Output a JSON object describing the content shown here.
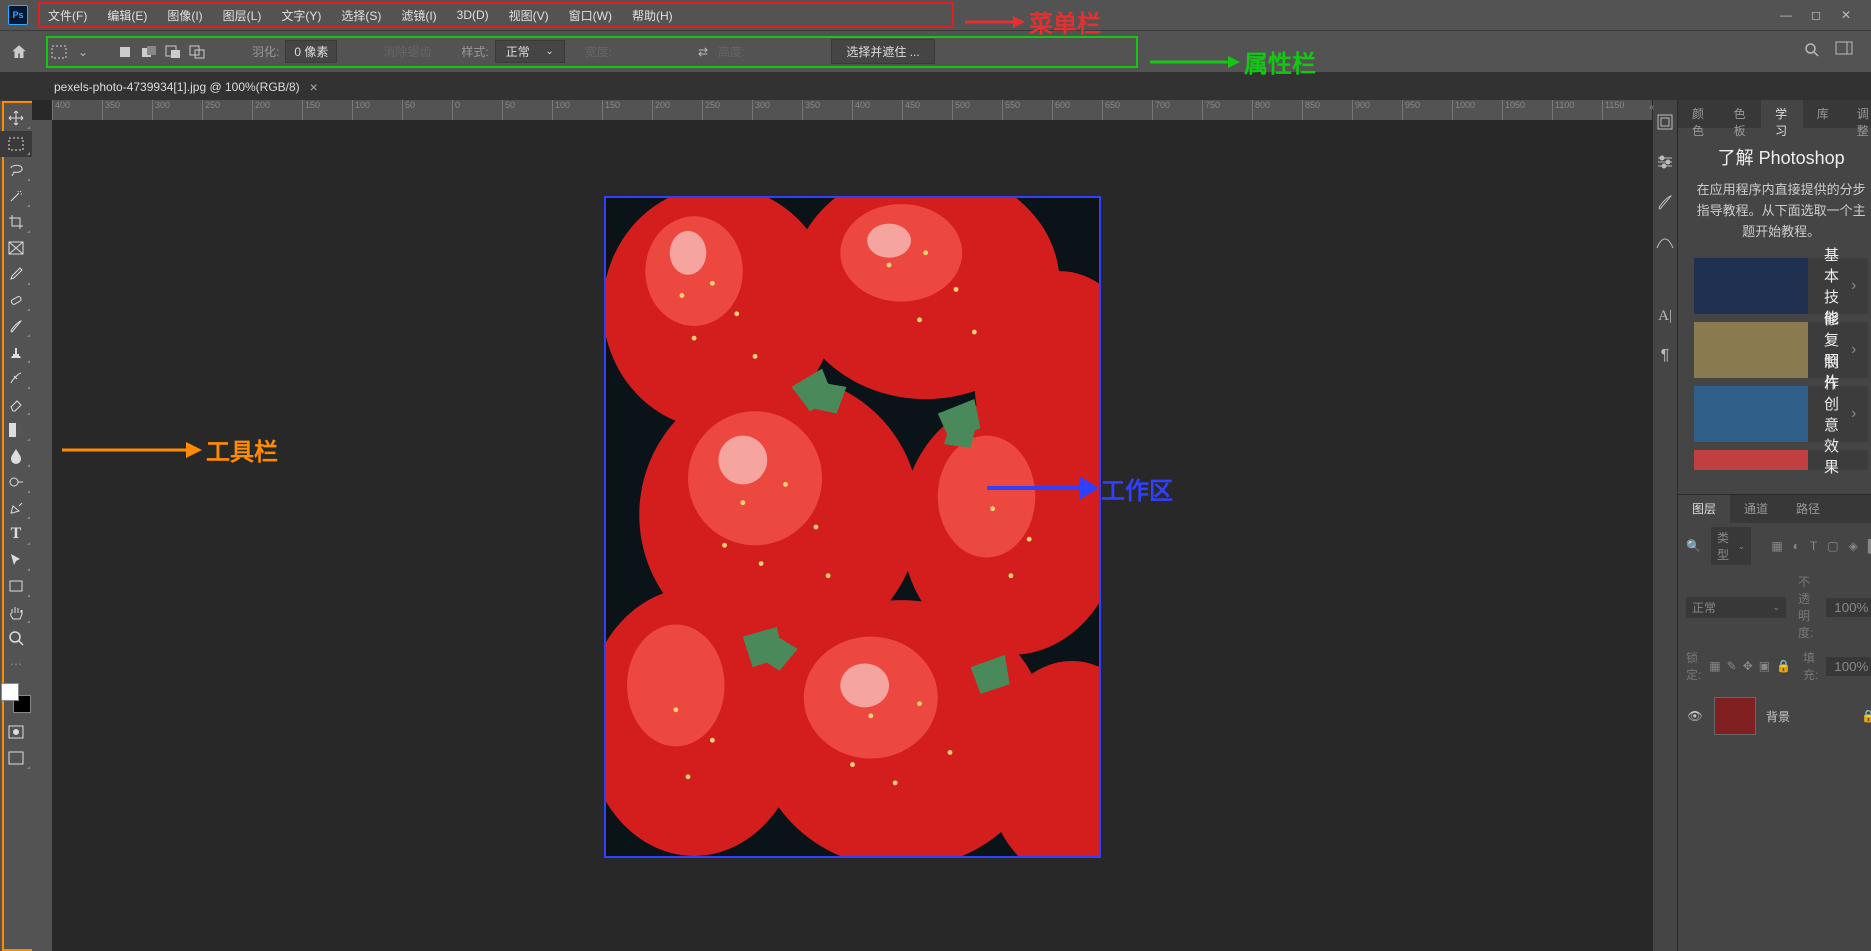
{
  "app": {
    "logo": "Ps"
  },
  "menubar": {
    "items": [
      "文件(F)",
      "编辑(E)",
      "图像(I)",
      "图层(L)",
      "文字(Y)",
      "选择(S)",
      "滤镜(I)",
      "3D(D)",
      "视图(V)",
      "窗口(W)",
      "帮助(H)"
    ]
  },
  "options": {
    "feather_label": "羽化:",
    "feather_value": "0 像素",
    "antialias": "消除锯齿",
    "style_label": "样式:",
    "style_value": "正常",
    "width_label": "宽度:",
    "height_label": "高度:",
    "mask_btn": "选择并遮住 ..."
  },
  "document": {
    "tab_title": "pexels-photo-4739934[1].jpg @ 100%(RGB/8)"
  },
  "ruler_ticks": [
    "400",
    "350",
    "300",
    "250",
    "200",
    "150",
    "100",
    "50",
    "0",
    "50",
    "100",
    "150",
    "200",
    "250",
    "300",
    "350",
    "400",
    "450",
    "500",
    "550",
    "600",
    "650",
    "700",
    "750",
    "800",
    "850",
    "900",
    "950",
    "1000",
    "1050",
    "1100",
    "1150"
  ],
  "right_tabs": {
    "color": "颜色",
    "swatches": "色板",
    "learn": "学习",
    "libraries": "库",
    "adjust": "调整"
  },
  "learn": {
    "title": "了解 Photoshop",
    "desc": "在应用程序内直接提供的分步指导教程。从下面选取一个主题开始教程。",
    "items": [
      "基本技能",
      "修复照片",
      "制作创意效果"
    ]
  },
  "layers_tabs": {
    "layers": "图层",
    "channels": "通道",
    "paths": "路径"
  },
  "layers": {
    "kind_label": "类型",
    "blend": "正常",
    "opacity_label": "不透明度:",
    "opacity_value": "100%",
    "lock_label": "锁定:",
    "fill_label": "填充:",
    "fill_value": "100%",
    "bg_layer": "背景"
  },
  "annotations": {
    "menubar": "菜单栏",
    "options": "属性栏",
    "toolbox": "工具栏",
    "canvas": "工作区"
  }
}
